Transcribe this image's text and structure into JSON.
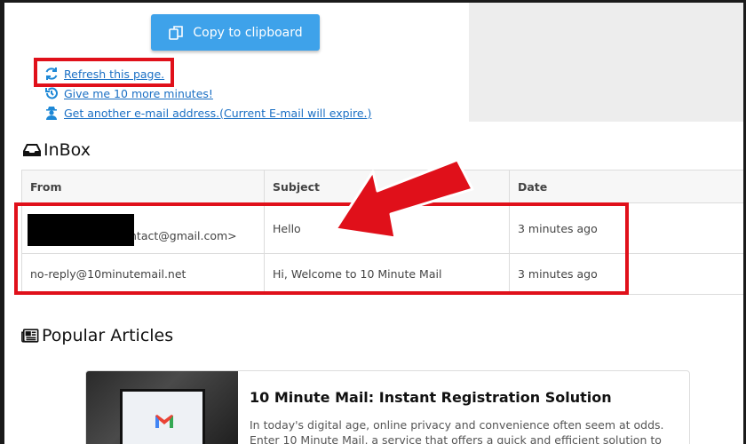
{
  "actions": {
    "copy_label": "Copy to clipboard",
    "links": [
      {
        "label": "Refresh this page.",
        "icon": "refresh-icon"
      },
      {
        "label": "Give me 10 more minutes!",
        "icon": "history-icon"
      },
      {
        "label": "Get another e-mail address.(Current E-mail will expire.)",
        "icon": "user-secret-icon"
      }
    ]
  },
  "inbox": {
    "title": "InBox",
    "columns": [
      "From",
      "Subject",
      "Date"
    ],
    "rows": [
      {
        "from": "ntact@gmail.com>",
        "subject": "Hello",
        "date": "3 minutes ago"
      },
      {
        "from": "no-reply@10minutemail.net",
        "subject": "Hi, Welcome to 10 Minute Mail",
        "date": "3 minutes ago"
      }
    ]
  },
  "popular": {
    "title": "Popular Articles",
    "articles": [
      {
        "title": "10 Minute Mail: Instant Registration Solution",
        "excerpt": "In today's digital age, online privacy and convenience often seem at odds. Enter 10 Minute Mail, a service that offers a quick and efficient solution to one of the internet's most"
      }
    ]
  },
  "colors": {
    "button": "#3ea2ea",
    "link": "#1a6fc4",
    "annotation": "#e0101a"
  }
}
